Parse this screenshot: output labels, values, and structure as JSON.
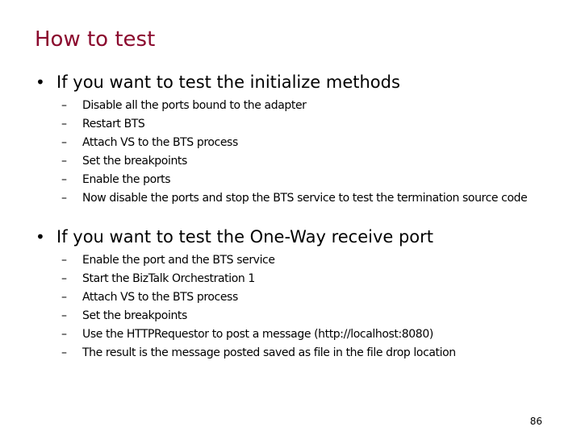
{
  "slide": {
    "title": "How to test",
    "page_number": "86",
    "title_color": "#8b0a2e",
    "sections": [
      {
        "heading": "If you want to test the initialize methods",
        "bullet": "•",
        "items": [
          "Disable all the ports bound to the adapter",
          "Restart BTS",
          "Attach VS to the BTS process",
          "Set the breakpoints",
          "Enable the ports",
          "Now disable the ports and stop the BTS service to test the termination source code"
        ]
      },
      {
        "heading": "If you want to test the One-Way receive port",
        "bullet": "•",
        "items": [
          "Enable the port and the BTS service",
          "Start the BizTalk Orchestration 1",
          "Attach VS to the BTS process",
          "Set the breakpoints",
          "Use the HTTPRequestor to post a message (http://localhost:8080)",
          "The result is the message posted saved as file in the file drop location"
        ]
      }
    ],
    "sub_bullet": "–"
  }
}
